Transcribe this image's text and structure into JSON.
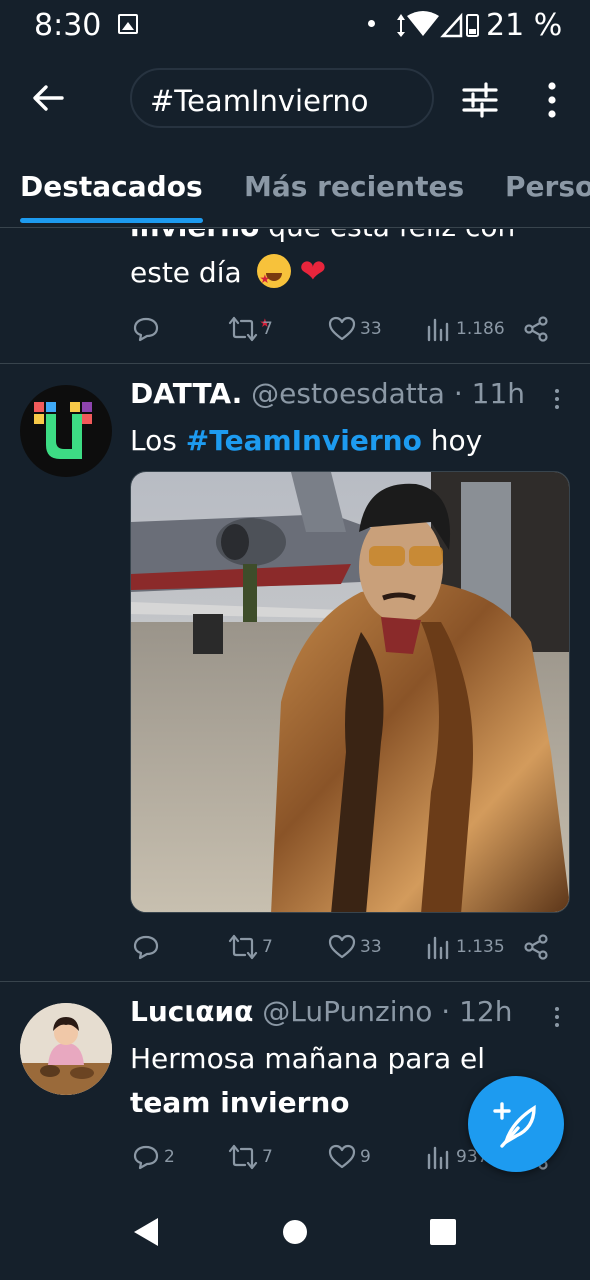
{
  "status_bar": {
    "time": "8:30",
    "battery": "21 %"
  },
  "header": {
    "search_query": "#TeamInvierno"
  },
  "tabs": [
    {
      "label": "Destacados",
      "active": true
    },
    {
      "label": "Más recientes",
      "active": false
    },
    {
      "label": "Perso",
      "active": false
    }
  ],
  "tweets": [
    {
      "text_bold": "invierno",
      "text_line1_rest": " que está feliz con",
      "text_line2": "este día",
      "emojis": [
        "star-struck-emoji",
        "red-heart-emoji"
      ],
      "retweets": "7",
      "likes": "33",
      "views": "1.186"
    },
    {
      "name": "DATTA.",
      "handle": "@estoesdatta",
      "time": "· 11h",
      "text_prefix": "Los ",
      "hashtag": "#TeamInvierno",
      "text_suffix": " hoy",
      "retweets": "7",
      "likes": "33",
      "views": "1.135"
    },
    {
      "name": "Lucιαиα",
      "handle": "@LuPunzino",
      "time": "· 12h",
      "text_line1": "Hermosa mañana para el",
      "text_bold": "team invierno",
      "replies": "2",
      "retweets": "7",
      "likes": "9",
      "views": "937"
    }
  ],
  "colors": {
    "background": "#15202b",
    "accent": "#1d9bf0",
    "muted": "#8b98a5",
    "divider": "#38444d"
  }
}
